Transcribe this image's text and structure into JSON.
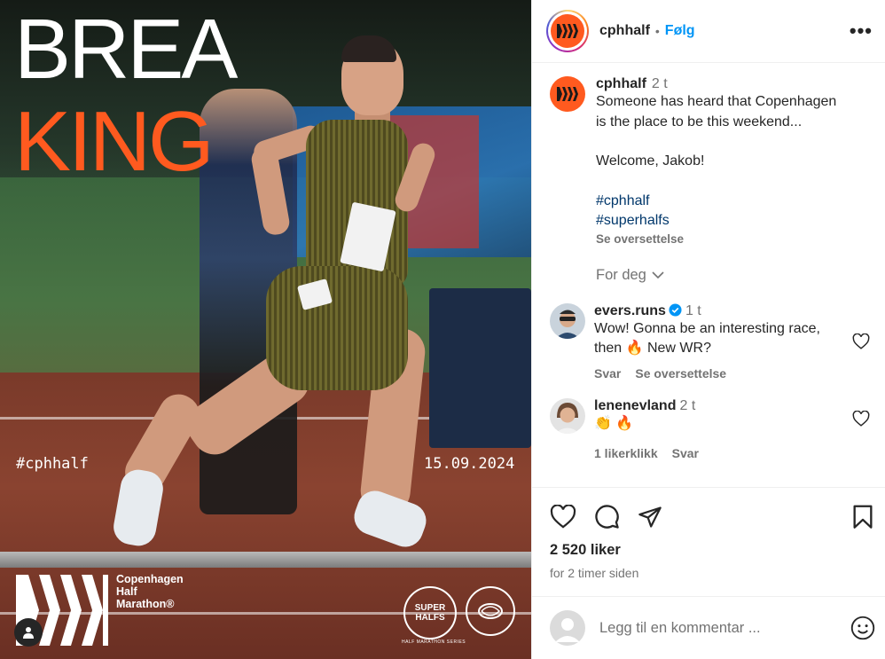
{
  "poster": {
    "title_line1": "BREA",
    "title_line2": "KING",
    "hashtag": "#cphhalf",
    "date": "15.09.2024",
    "brand_lines": [
      "Copenhagen",
      "Half",
      "Marathon®"
    ],
    "superhalfs_label_1": "SUPER",
    "superhalfs_label_2": "HALFS",
    "superhalfs_sub": "HALF MARATHON SERIES",
    "accent_color": "#ff5a1f"
  },
  "header": {
    "username": "cphhalf",
    "separator": "•",
    "follow_label": "Følg",
    "more_label": "•••"
  },
  "caption": {
    "username": "cphhalf",
    "time": "2 t",
    "line1": "Someone has heard that Copenhagen",
    "line2": "is the place to be this weekend...",
    "line3": "Welcome, Jakob!",
    "tags": [
      "#cphhalf",
      "#superhalfs"
    ],
    "translate_label": "Se oversettelse"
  },
  "for_deg_label": "For deg",
  "comments": [
    {
      "username": "evers.runs",
      "verified": true,
      "time": "1 t",
      "text_line1": "Wow! Gonna be an interesting race,",
      "text_line2_pre": "then",
      "emoji1": "🔥",
      "text_line2_post": "New WR?",
      "reply_label": "Svar",
      "translate_label": "Se oversettelse"
    },
    {
      "username": "lenenevland",
      "time": "2 t",
      "emoji_text": "👏 🔥",
      "likes_label": "1 likerklikk",
      "reply_label": "Svar"
    }
  ],
  "stats": {
    "likes": "2 520 liker",
    "when": "for 2 timer siden"
  },
  "add_comment": {
    "placeholder": "Legg til en kommentar ..."
  },
  "icons": {
    "like": "heart-icon",
    "comment": "comment-icon",
    "share": "share-icon",
    "save": "bookmark-icon",
    "emoji": "emoji-icon",
    "user_tag": "user-tag-icon"
  },
  "colors": {
    "follow": "#0095f6",
    "hashtag": "#00376b",
    "muted": "#737373",
    "brand_orange": "#ff5a1f"
  }
}
